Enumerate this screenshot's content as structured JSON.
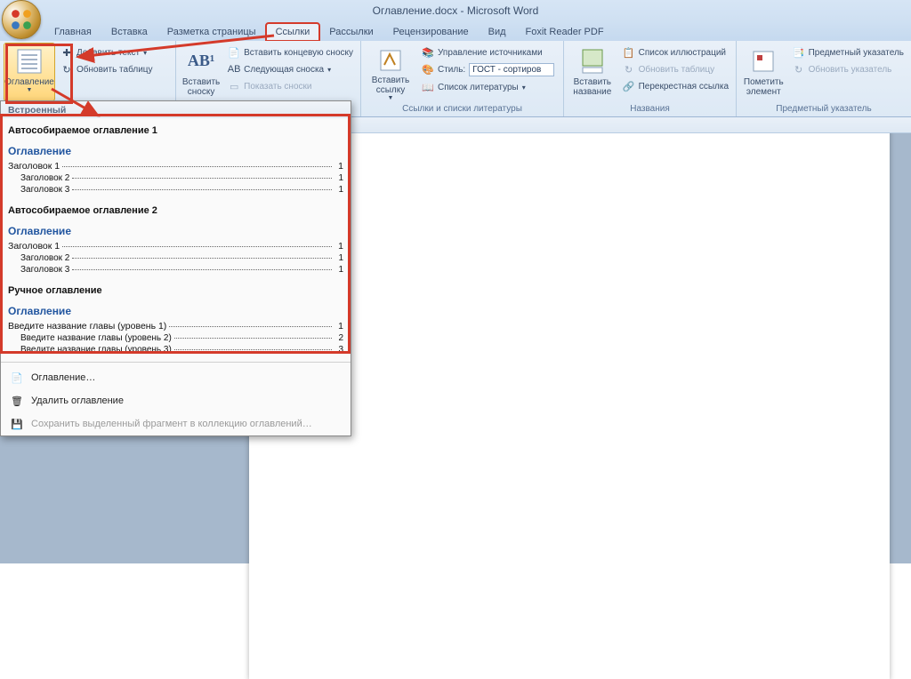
{
  "title": "Оглавление.docx - Microsoft Word",
  "tabs": {
    "home": "Главная",
    "insert": "Вставка",
    "layout": "Разметка страницы",
    "references": "Ссылки",
    "mailings": "Рассылки",
    "review": "Рецензирование",
    "view": "Вид",
    "foxit": "Foxit Reader PDF"
  },
  "ribbon": {
    "toc": {
      "btn": "Оглавление",
      "add_text": "Добавить текст",
      "update": "Обновить таблицу"
    },
    "footnotes": {
      "btn": "Вставить сноску",
      "big_label": "AB¹",
      "endnote": "Вставить концевую сноску",
      "next": "Следующая сноска",
      "show": "Показать сноски"
    },
    "citations": {
      "btn": "Вставить ссылку",
      "sources": "Управление источниками",
      "style_label": "Стиль:",
      "style_value": "ГОСТ - сортиров",
      "biblio": "Список литературы",
      "group": "Ссылки и списки литературы"
    },
    "captions": {
      "btn": "Вставить название",
      "list_fig": "Список иллюстраций",
      "update": "Обновить таблицу",
      "crossref": "Перекрестная ссылка",
      "group": "Названия"
    },
    "index": {
      "btn": "Пометить элемент",
      "insert": "Предметный указатель",
      "update": "Обновить указатель",
      "group": "Предметный указатель"
    }
  },
  "gallery": {
    "builtin_header": "Встроенный",
    "auto1": {
      "name": "Автособираемое оглавление 1",
      "title": "Оглавление",
      "rows": [
        {
          "label": "Заголовок 1",
          "level": 1,
          "page": "1"
        },
        {
          "label": "Заголовок 2",
          "level": 2,
          "page": "1"
        },
        {
          "label": "Заголовок 3",
          "level": 2,
          "page": "1"
        }
      ]
    },
    "auto2": {
      "name": "Автособираемое оглавление 2",
      "title": "Оглавление",
      "rows": [
        {
          "label": "Заголовок 1",
          "level": 1,
          "page": "1"
        },
        {
          "label": "Заголовок 2",
          "level": 2,
          "page": "1"
        },
        {
          "label": "Заголовок 3",
          "level": 2,
          "page": "1"
        }
      ]
    },
    "manual": {
      "name": "Ручное оглавление",
      "title": "Оглавление",
      "rows": [
        {
          "label": "Введите название главы (уровень 1)",
          "level": 1,
          "page": "1"
        },
        {
          "label": "Введите название главы (уровень 2)",
          "level": 2,
          "page": "2"
        },
        {
          "label": "Введите название главы (уровень 3)",
          "level": 2,
          "page": "3"
        }
      ]
    },
    "menu": {
      "insert_toc": "Оглавление…",
      "remove_toc": "Удалить оглавление",
      "save_selection": "Сохранить выделенный фрагмент в коллекцию оглавлений…"
    }
  }
}
